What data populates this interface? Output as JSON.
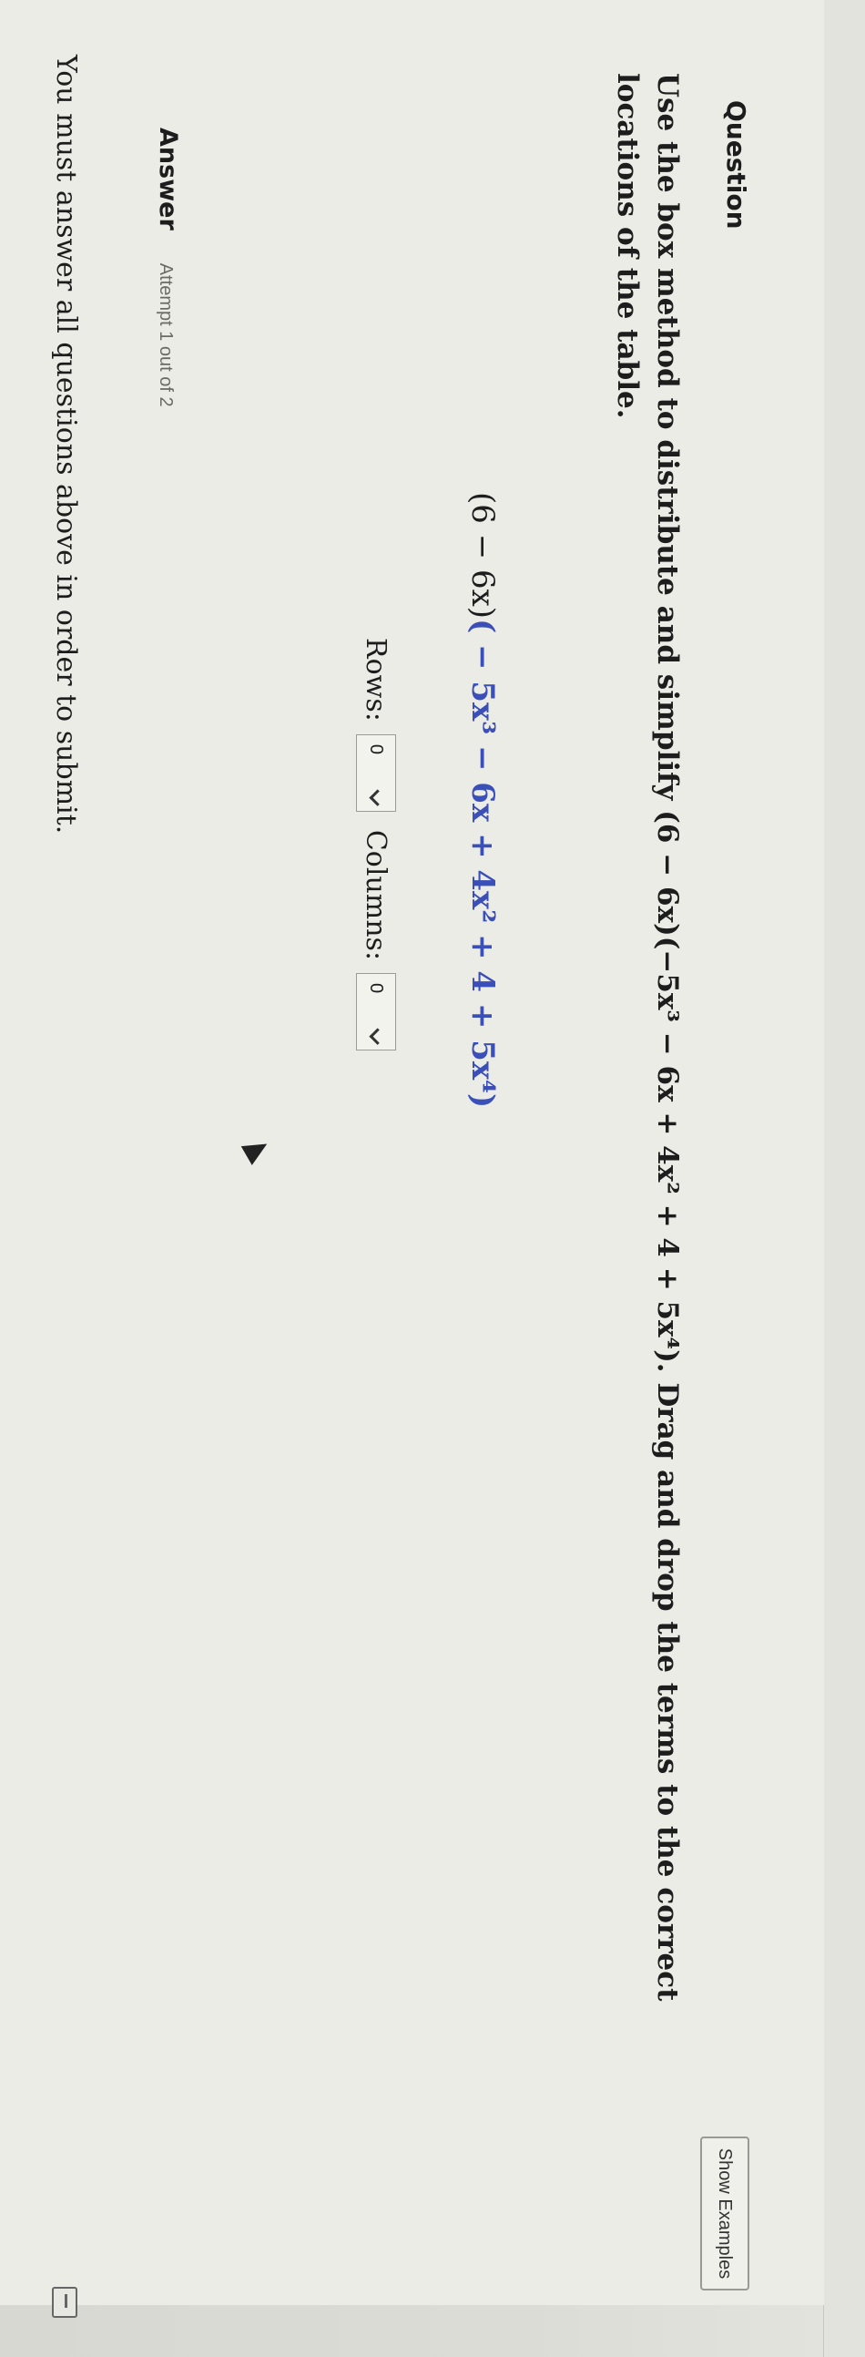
{
  "question": {
    "heading": "Question",
    "show_examples": "Show Examples",
    "prompt_text": "Use the box method to distribute and simplify (6 − 6x)(−5x³ − 6x + 4x² + 4 + 5x⁴). Drag and drop the terms to the correct locations of the table.",
    "expression_left": "(6 − 6x)",
    "expression_right": "( − 5x³ − 6x + 4x² + 4 + 5x⁴)",
    "rows_label": "Rows:",
    "rows_value": "0",
    "columns_label": "Columns:",
    "columns_value": "0"
  },
  "answer": {
    "label": "Answer",
    "attempt": "Attempt 1 out of 2",
    "notice": "You must answer all questions above in order to submit."
  }
}
